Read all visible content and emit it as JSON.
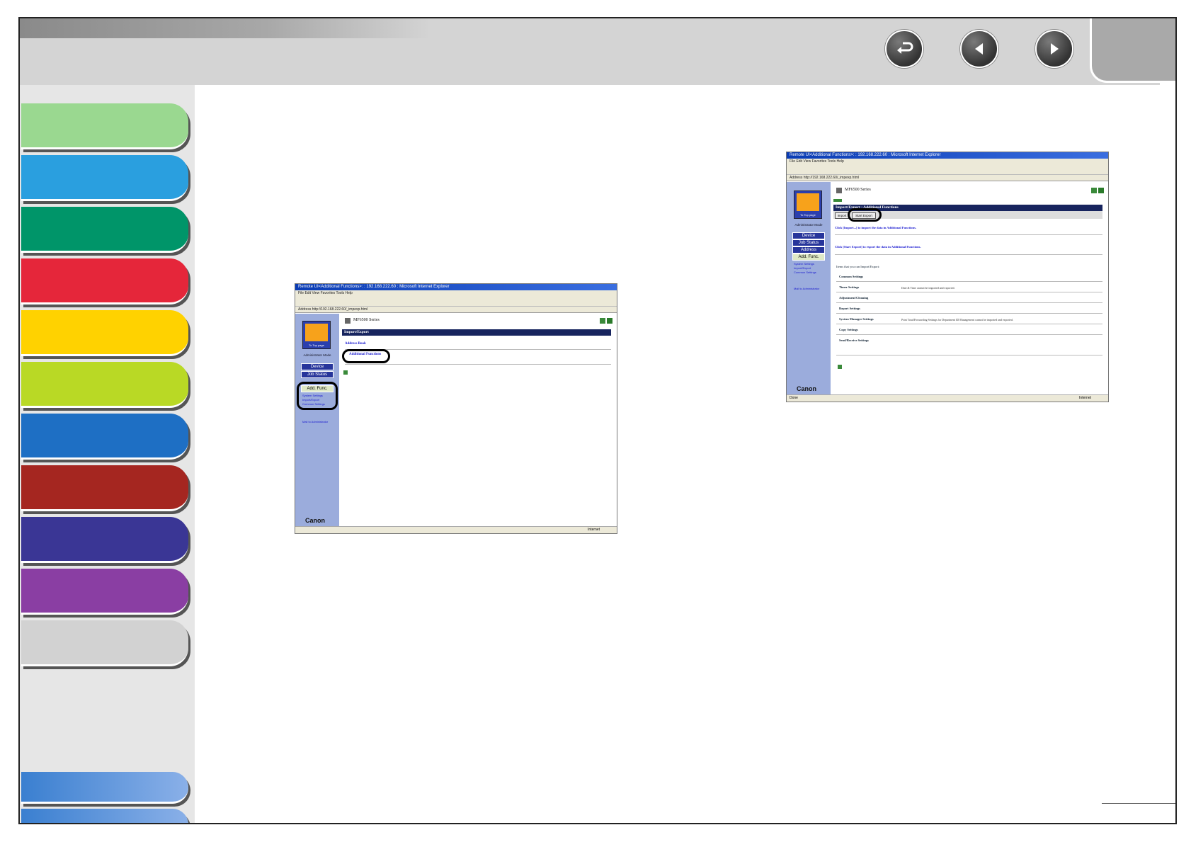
{
  "nav": {
    "back_label": "back",
    "prev_label": "previous",
    "next_label": "next"
  },
  "window1": {
    "title": "Remote UI<Additional Functions>: : 192.168.222.60 : Microsoft Internet Explorer",
    "menu": "File  Edit  View  Favorites  Tools  Help",
    "address": "Address  http://192.168.222.60/_impexp.html",
    "logo_caption": "To Top page",
    "mode": "Administrator Mode",
    "nav_items": [
      "Device",
      "Job Status"
    ],
    "add_func": "Add. Func.",
    "sub_links": [
      "System Settings",
      "Import/Export",
      "Common Settings"
    ],
    "mail": "Mail to Administrator",
    "product": "MF6500 Series",
    "section": "Import/Export",
    "rows": [
      "Address Book",
      "Additional Functions"
    ],
    "canon": "Canon",
    "status_right": "Internet"
  },
  "window2": {
    "title": "Remote UI<Additional Functions>: : 192.168.222.60 : Microsoft Internet Explorer",
    "menu": "File  Edit  View  Favorites  Tools  Help",
    "address": "Address  http://192.168.222.60/_impexp.html",
    "logo_caption": "To Top page",
    "mode": "Administrator Mode",
    "nav_items": [
      "Device",
      "Job Status",
      "Address"
    ],
    "add_func": "Add. Func.",
    "sub_links": [
      "System Settings",
      "Import/Export",
      "Common Settings"
    ],
    "mail": "Mail to Administrator",
    "product": "MF6500 Series",
    "section": "Import/Export : Additional Functions",
    "buttons": [
      "Import",
      "Start Export"
    ],
    "instr1": "Click [Import...] to import the data in Additional Functions.",
    "instr2": "Click [Start Export] to export the data in Additional Functions.",
    "items_intro": "Items that you can Import/Export:",
    "items": [
      {
        "label": "Common Settings",
        "desc": ""
      },
      {
        "label": "Timer Settings",
        "desc": "Date & Time cannot be imported and exported."
      },
      {
        "label": "Adjustment/Cleaning",
        "desc": ""
      },
      {
        "label": "Report Settings",
        "desc": ""
      },
      {
        "label": "System Manager Settings",
        "desc": "Print Total/Forwarding Settings for Department ID Management cannot be imported and exported."
      },
      {
        "label": "Copy Settings",
        "desc": ""
      },
      {
        "label": "Send/Receive Settings",
        "desc": ""
      }
    ],
    "canon": "Canon",
    "status_left": "Done",
    "status_right": "Internet"
  },
  "colors": {
    "tabs": [
      "#9ad890",
      "#2a9fdf",
      "#009569",
      "#e5263a",
      "#ffd200",
      "#b9d925",
      "#1e6fc4",
      "#a52620",
      "#3a3695",
      "#8a3ea3",
      "#d2d2d2"
    ]
  }
}
